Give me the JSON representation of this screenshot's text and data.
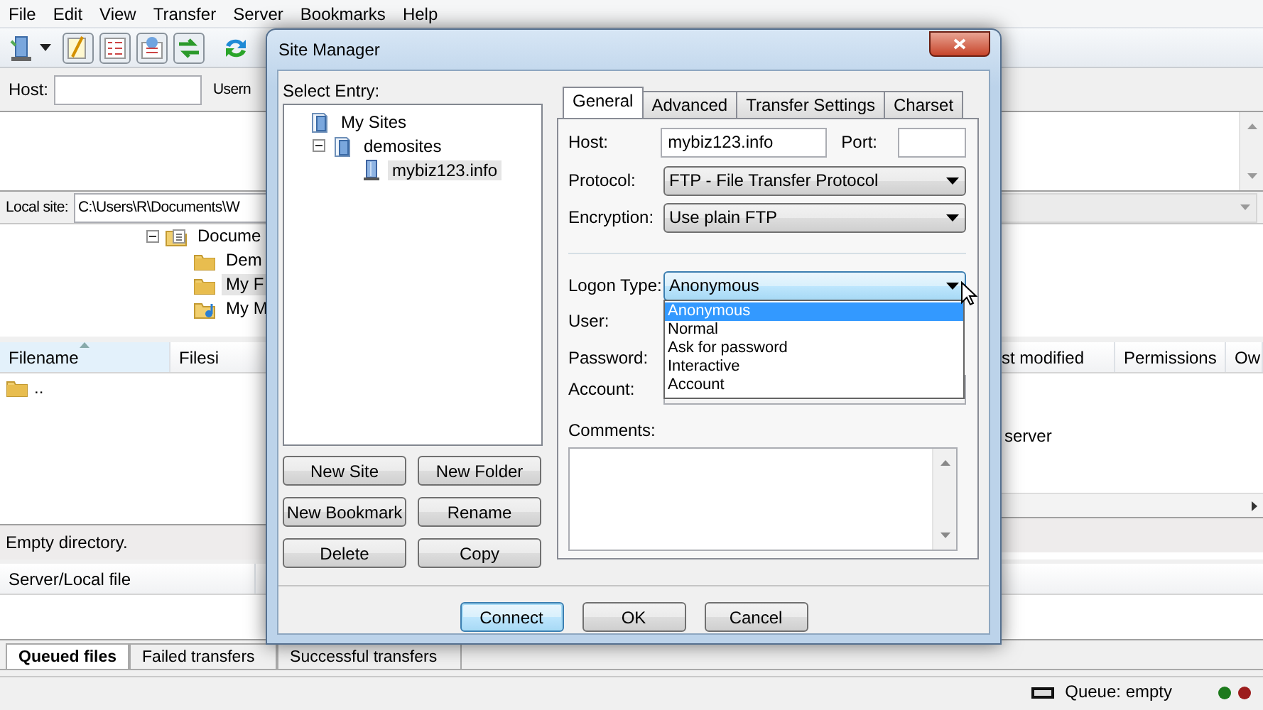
{
  "menu": [
    {
      "label": "File"
    },
    {
      "label": "Edit"
    },
    {
      "label": "View"
    },
    {
      "label": "Transfer"
    },
    {
      "label": "Server"
    },
    {
      "label": "Bookmarks"
    },
    {
      "label": "Help"
    }
  ],
  "quickconnect": {
    "host_label": "Host:",
    "username_label": "Usern"
  },
  "local_site": {
    "label": "Local site:",
    "path": "C:\\Users\\R\\Documents\\W"
  },
  "local_tree": [
    {
      "label": "Docume",
      "kind": "documents",
      "selected": false,
      "expanded": true,
      "children": [
        {
          "label": "Dem",
          "kind": "folder",
          "selected": false
        },
        {
          "label": "My F",
          "kind": "folder",
          "selected": true
        },
        {
          "label": "My M",
          "kind": "music",
          "selected": false
        }
      ]
    }
  ],
  "local_list": {
    "columns": [
      "Filename",
      "Filesi"
    ],
    "rows": [
      ".."
    ],
    "status": "Empty directory."
  },
  "remote_list": {
    "columns": [
      "st modified",
      "Permissions",
      "Ow"
    ],
    "message": "server"
  },
  "queue": {
    "columns": [
      "Server/Local file"
    ],
    "tabs": [
      {
        "label": "Queued files",
        "selected": true
      },
      {
        "label": "Failed transfers",
        "selected": false
      },
      {
        "label": "Successful transfers",
        "selected": false
      }
    ]
  },
  "status_bar": {
    "queue": "Queue: empty"
  },
  "dialog": {
    "title": "Site Manager",
    "select_entry_label": "Select Entry:",
    "tree": [
      {
        "label": "My Sites",
        "kind": "sites",
        "selected": false,
        "children": [
          {
            "label": "demosites",
            "kind": "sites",
            "selected": false,
            "expanded": true,
            "children": [
              {
                "label": "mybiz123.info",
                "kind": "server",
                "selected": true
              }
            ]
          }
        ]
      }
    ],
    "tree_buttons": [
      "New Site",
      "New Folder",
      "New Bookmark",
      "Rename",
      "Delete",
      "Copy"
    ],
    "tabs": [
      {
        "label": "General",
        "selected": true
      },
      {
        "label": "Advanced",
        "selected": false
      },
      {
        "label": "Transfer Settings",
        "selected": false
      },
      {
        "label": "Charset",
        "selected": false
      }
    ],
    "general": {
      "host_label": "Host:",
      "host_value": "mybiz123.info",
      "port_label": "Port:",
      "protocol_label": "Protocol:",
      "protocol_value": "FTP - File Transfer Protocol",
      "encryption_label": "Encryption:",
      "encryption_value": "Use plain FTP",
      "logon_label": "Logon Type:",
      "logon_value": "Anonymous",
      "logon_expanded": true,
      "logon_options": [
        {
          "label": "Anonymous",
          "selected": true
        },
        {
          "label": "Normal",
          "selected": false
        },
        {
          "label": "Ask for password",
          "selected": false
        },
        {
          "label": "Interactive",
          "selected": false
        },
        {
          "label": "Account",
          "selected": false
        }
      ],
      "user_label": "User:",
      "password_label": "Password:",
      "account_label": "Account:",
      "comments_label": "Comments:"
    },
    "buttons": [
      {
        "label": "Connect",
        "focused": true
      },
      {
        "label": "OK",
        "focused": false
      },
      {
        "label": "Cancel",
        "focused": false
      }
    ]
  }
}
